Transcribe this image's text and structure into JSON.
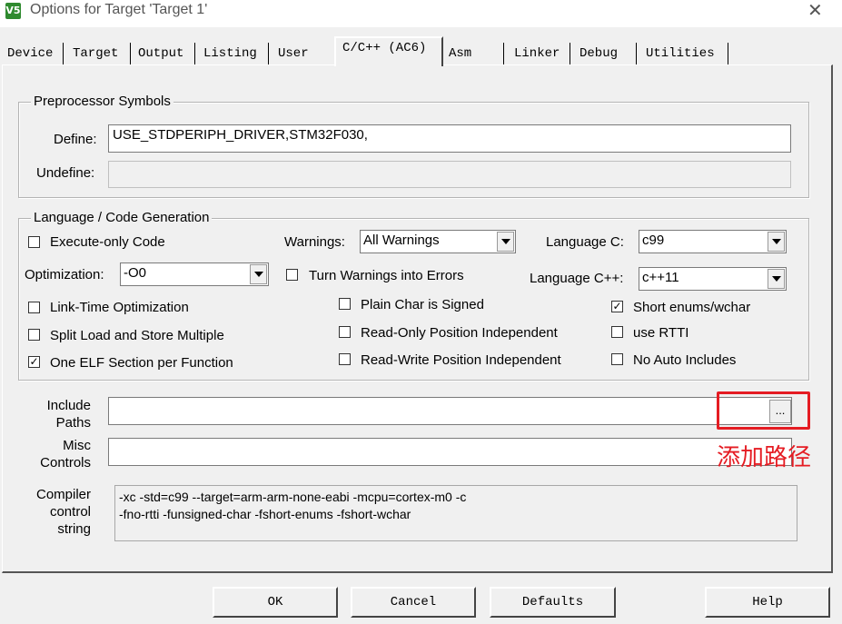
{
  "window": {
    "app_icon": "V5",
    "title": "Options for Target 'Target 1'",
    "close_glyph": "✕"
  },
  "tabs": [
    "Device",
    "Target",
    "Output",
    "Listing",
    "User",
    "C/C++ (AC6)",
    "Asm",
    "Linker",
    "Debug",
    "Utilities"
  ],
  "active_tab": "C/C++ (AC6)",
  "preprocessor": {
    "legend": "Preprocessor Symbols",
    "define_label": "Define:",
    "define_value": "USE_STDPERIPH_DRIVER,STM32F030,",
    "undefine_label": "Undefine:",
    "undefine_value": ""
  },
  "language": {
    "legend": "Language / Code Generation",
    "execute_only": {
      "label": "Execute-only Code",
      "checked": false
    },
    "warnings_label": "Warnings:",
    "warnings_value": "All Warnings",
    "language_c_label": "Language C:",
    "language_c_value": "c99",
    "optimization_label": "Optimization:",
    "optimization_value": "-O0",
    "turn_warnings": {
      "label": "Turn Warnings into Errors",
      "checked": false
    },
    "language_cpp_label": "Language C++:",
    "language_cpp_value": "c++11",
    "link_time": {
      "label": "Link-Time Optimization",
      "checked": false
    },
    "plain_char": {
      "label": "Plain Char is Signed",
      "checked": false
    },
    "short_enums": {
      "label": "Short enums/wchar",
      "checked": true
    },
    "split_load": {
      "label": "Split Load and Store Multiple",
      "checked": false
    },
    "ro_pos": {
      "label": "Read-Only Position Independent",
      "checked": false
    },
    "use_rtti": {
      "label": "use RTTI",
      "checked": false
    },
    "one_elf": {
      "label": "One ELF Section per Function",
      "checked": true
    },
    "rw_pos": {
      "label": "Read-Write Position Independent",
      "checked": false
    },
    "no_auto": {
      "label": "No Auto Includes",
      "checked": false
    }
  },
  "include_paths": {
    "label_line1": "Include",
    "label_line2": "Paths",
    "value": "",
    "browse_label": "..."
  },
  "misc_controls": {
    "label_line1": "Misc",
    "label_line2": "Controls",
    "value": ""
  },
  "compiler_string": {
    "label_line1": "Compiler",
    "label_line2": "control",
    "label_line3": "string",
    "line1": "-xc -std=c99 --target=arm-arm-none-eabi -mcpu=cortex-m0 -c",
    "line2": "-fno-rtti -funsigned-char -fshort-enums -fshort-wchar"
  },
  "annotation": {
    "text": "添加路径",
    "color": "#e51c23"
  },
  "buttons": {
    "ok": "OK",
    "cancel": "Cancel",
    "defaults": "Defaults",
    "help": "Help"
  },
  "check_glyph": "✓"
}
